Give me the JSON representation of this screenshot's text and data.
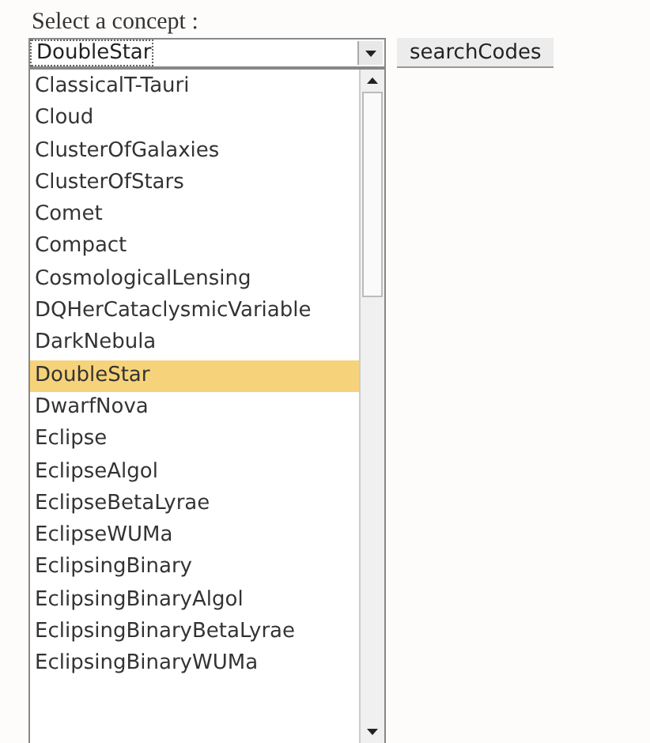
{
  "label": "Select a concept :",
  "select": {
    "value": "DoubleStar",
    "expanded": true
  },
  "button": "searchCodes",
  "options": [
    {
      "label": "ClassicalT-Tauri",
      "selected": false
    },
    {
      "label": "Cloud",
      "selected": false
    },
    {
      "label": "ClusterOfGalaxies",
      "selected": false
    },
    {
      "label": "ClusterOfStars",
      "selected": false
    },
    {
      "label": "Comet",
      "selected": false
    },
    {
      "label": "Compact",
      "selected": false
    },
    {
      "label": "CosmologicalLensing",
      "selected": false
    },
    {
      "label": "DQHerCataclysmicVariable",
      "selected": false
    },
    {
      "label": "DarkNebula",
      "selected": false
    },
    {
      "label": "DoubleStar",
      "selected": true
    },
    {
      "label": "DwarfNova",
      "selected": false
    },
    {
      "label": "Eclipse",
      "selected": false
    },
    {
      "label": "EclipseAlgol",
      "selected": false
    },
    {
      "label": "EclipseBetaLyrae",
      "selected": false
    },
    {
      "label": "EclipseWUMa",
      "selected": false
    },
    {
      "label": "EclipsingBinary",
      "selected": false
    },
    {
      "label": "EclipsingBinaryAlgol",
      "selected": false
    },
    {
      "label": "EclipsingBinaryBetaLyrae",
      "selected": false
    },
    {
      "label": "EclipsingBinaryWUMa",
      "selected": false
    }
  ]
}
